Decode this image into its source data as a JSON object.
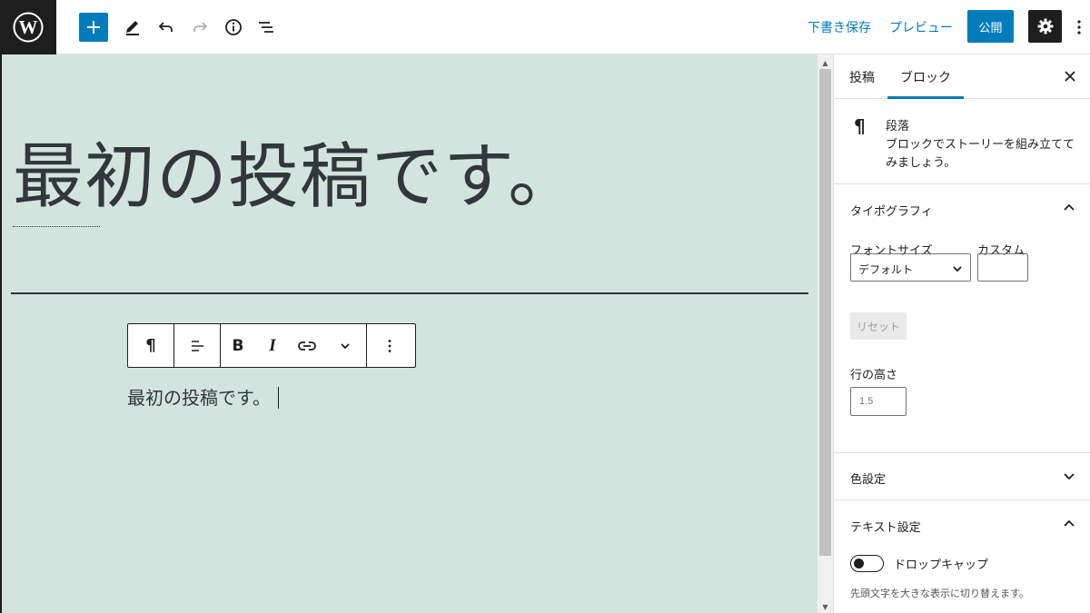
{
  "toolbar": {
    "save_draft": "下書き保存",
    "preview": "プレビュー",
    "publish": "公開"
  },
  "editor": {
    "title": "最初の投稿です。",
    "paragraph": "最初の投稿です。"
  },
  "sidebar": {
    "tabs": [
      "投稿",
      "ブロック"
    ],
    "active_tab": "ブロック",
    "block": {
      "name": "段落",
      "description": "ブロックでストーリーを組み立ててみましょう。"
    },
    "typography": {
      "title": "タイポグラフィ",
      "font_size_label": "フォントサイズ",
      "custom_label": "カスタム",
      "font_size_value": "デフォルト",
      "reset": "リセット",
      "line_height_label": "行の高さ",
      "line_height_placeholder": "1.5"
    },
    "color": {
      "title": "色設定"
    },
    "text_settings": {
      "title": "テキスト設定",
      "drop_cap_label": "ドロップキャップ",
      "drop_cap_help": "先頭文字を大きな表示に切り替えます。"
    }
  },
  "colors": {
    "accent": "#007cba",
    "canvas_bg": "#d2e4de",
    "dark": "#1e1e1e"
  }
}
